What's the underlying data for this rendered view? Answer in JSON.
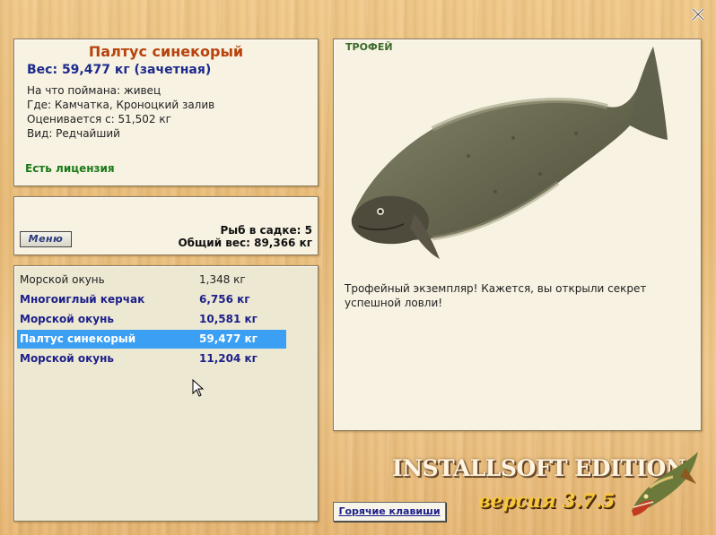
{
  "fish": {
    "name": "Палтус синекорый",
    "weight": "Вес: 59,477 кг (зачетная)",
    "caught_on": "На что поймана: живец",
    "location": "Где: Камчатка, Кроноцкий залив",
    "valued_from": "Оценивается с: 51,502 кг",
    "kind": "Вид: Редчайший",
    "license": "Есть лицензия"
  },
  "keepnet": {
    "menu_label": "Меню",
    "fish_count": "Рыб в садке: 5",
    "total_weight": "Общий вес: 89,366 кг"
  },
  "catch_list": [
    {
      "name": "Морской окунь",
      "weight": "1,348 кг",
      "style": "plain"
    },
    {
      "name": "Многоиглый керчак",
      "weight": "6,756 кг",
      "style": "bold"
    },
    {
      "name": "Морской окунь",
      "weight": "10,581 кг",
      "style": "bold"
    },
    {
      "name": "Палтус синекорый",
      "weight": "59,477 кг",
      "style": "sel"
    },
    {
      "name": "Морской окунь",
      "weight": "11,204 кг",
      "style": "bold"
    }
  ],
  "photo": {
    "tag": "ТРОФЕЙ",
    "description": "Трофейный экземпляр! Кажется, вы открыли секрет успешной ловли!"
  },
  "footer": {
    "hotkeys_label": "Горячие клавиши",
    "brand": "INSTALLSOFT EDITION",
    "version": "версия 3.7.5"
  },
  "colors": {
    "title": "#b8420c",
    "weight": "#1c2a8c",
    "license": "#1a7a18",
    "selection": "#3ba0f4"
  },
  "icons": [
    "close-icon",
    "pike-logo-icon",
    "mouse-cursor-icon"
  ]
}
